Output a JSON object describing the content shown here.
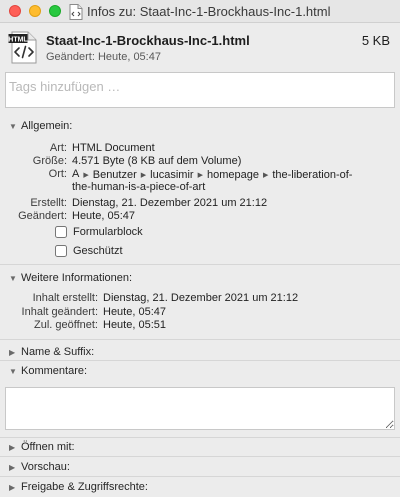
{
  "window": {
    "title": "Infos zu: Staat-Inc-1-Brockhaus-Inc-1.html",
    "file_icon_badge": "HTML"
  },
  "header": {
    "filename": "Staat-Inc-1-Brockhaus-Inc-1.html",
    "size": "5 KB",
    "modified": "Geändert: Heute, 05:47"
  },
  "tags": {
    "placeholder": "Tags hinzufügen …"
  },
  "general": {
    "title": "Allgemein:",
    "kind_label": "Art:",
    "kind_value": "HTML Document",
    "size_label": "Größe:",
    "size_value": "4.571 Byte (8 KB auf dem Volume)",
    "where_label": "Ort:",
    "path": [
      "A",
      "Benutzer",
      "lucasimir",
      "homepage",
      "the-liberation-of-"
    ],
    "path_continuation": "the-human-is-a-piece-of-art",
    "created_label": "Erstellt:",
    "created_value": "Dienstag, 21. Dezember 2021 um 21:12",
    "modified_label": "Geändert:",
    "modified_value": "Heute, 05:47",
    "stationery_label": "Formularblock",
    "locked_label": "Geschützt"
  },
  "more_info": {
    "title": "Weitere Informationen:",
    "content_created_label": "Inhalt erstellt:",
    "content_created_value": "Dienstag, 21. Dezember 2021 um 21:12",
    "content_modified_label": "Inhalt geändert:",
    "content_modified_value": "Heute, 05:47",
    "last_opened_label": "Zul. geöffnet:",
    "last_opened_value": "Heute, 05:51"
  },
  "sections": {
    "name_ext": "Name & Suffix:",
    "comments": "Kommentare:",
    "open_with": "Öffnen mit:",
    "preview": "Vorschau:",
    "sharing": "Freigabe & Zugriffsrechte:"
  }
}
